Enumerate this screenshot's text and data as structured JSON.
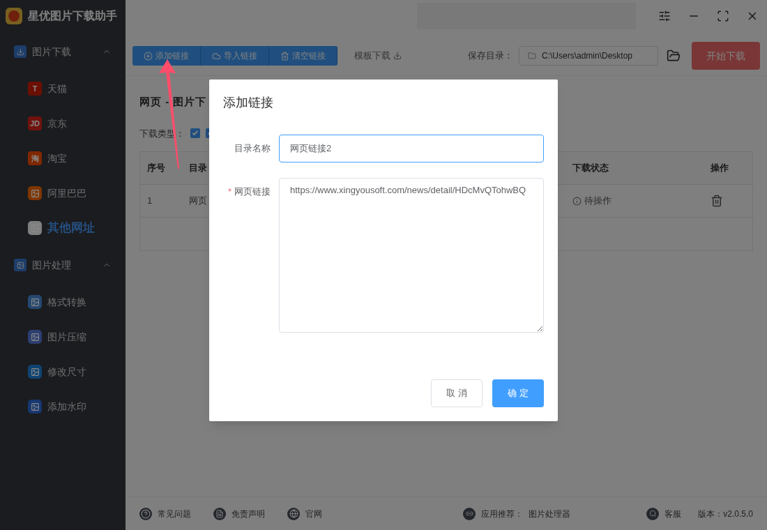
{
  "app": {
    "title": "星优图片下载助手"
  },
  "sidebar": {
    "groups": [
      {
        "label": "图片下载",
        "expanded": true,
        "kind": "download",
        "items": [
          {
            "label": "天猫",
            "selected": false,
            "color": "#6c0f03",
            "icon_text": "T"
          },
          {
            "label": "京东",
            "selected": false,
            "color": "#70120d",
            "icon_text": "JD"
          },
          {
            "label": "淘宝",
            "selected": false,
            "color": "#7f2800",
            "icon_text": "淘"
          },
          {
            "label": "阿里巴巴",
            "selected": false,
            "color": "#7f3500"
          },
          {
            "label": "其他网址",
            "selected": true,
            "color": "#7f7f7f"
          }
        ]
      },
      {
        "label": "图片处理",
        "expanded": true,
        "kind": "process",
        "items": [
          {
            "label": "格式转换",
            "selected": false,
            "color": "#254871"
          },
          {
            "label": "图片压缩",
            "selected": false,
            "color": "#2d3f70"
          },
          {
            "label": "修改尺寸",
            "selected": false,
            "color": "#0f4472"
          },
          {
            "label": "添加水印",
            "selected": false,
            "color": "#173770"
          }
        ]
      }
    ]
  },
  "toolbar": {
    "buttons": [
      {
        "label": "添加链接",
        "kind": "add"
      },
      {
        "label": "导入链接",
        "kind": "import"
      },
      {
        "label": "清空链接",
        "kind": "clear"
      }
    ],
    "template_link": "模板下载",
    "save_dir_label": "保存目录：",
    "save_dir": "C:\\Users\\admin\\Desktop",
    "start_button": "开始下载"
  },
  "section_title": "网页 - 图片下",
  "download_type": {
    "label": "下载类型：",
    "checkboxes": [
      {
        "checked": true
      },
      {
        "checked": true
      }
    ]
  },
  "table": {
    "columns": [
      "序号",
      "目录",
      "下载状态",
      "操作"
    ],
    "rows": [
      {
        "index": "1",
        "name": "网页",
        "status": "待操作"
      }
    ]
  },
  "footer": {
    "links": [
      {
        "label": "常见问题",
        "kind": "help"
      },
      {
        "label": "免责声明",
        "kind": "disclaimer"
      },
      {
        "label": "官网",
        "kind": "web"
      }
    ],
    "recommend_label": "应用推荐：",
    "recommend_app": "图片处理器",
    "service": "客服",
    "version": "版本：v2.0.5.0"
  },
  "dialog": {
    "title": "添加链接",
    "fields": [
      {
        "label": "目录名称",
        "kind": "input",
        "value": "网页链接2",
        "focused": true
      },
      {
        "label": "网页链接",
        "required_mark": "*",
        "kind": "textarea",
        "value": "https://www.xingyousoft.com/news/detail/HDcMvQTohwBQ",
        "focused": false
      }
    ],
    "buttons": [
      {
        "label": "取 消",
        "primary": false
      },
      {
        "label": "确 定",
        "primary": true
      }
    ]
  }
}
